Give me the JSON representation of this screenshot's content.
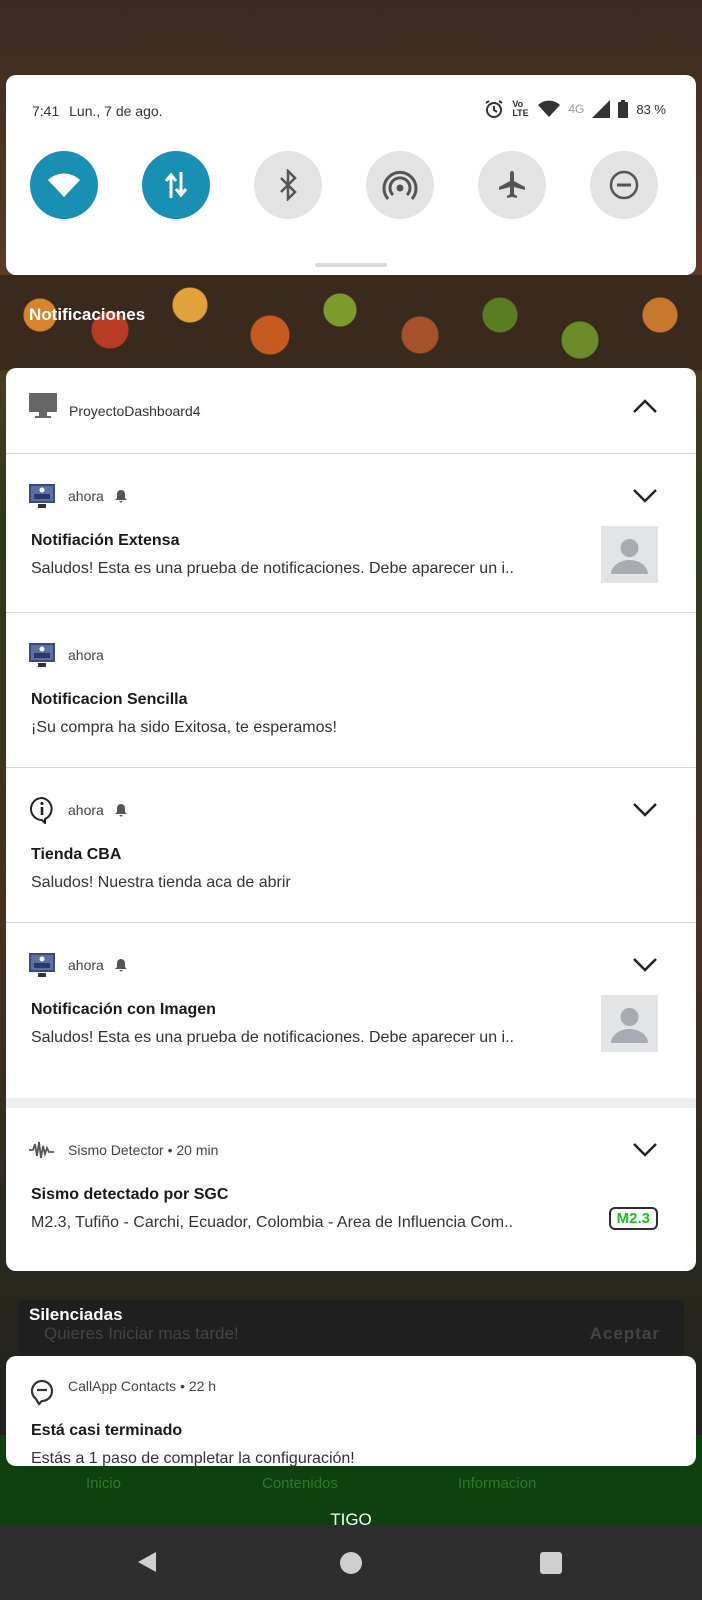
{
  "status_bar": {
    "time": "7:41",
    "date": "Lun., 7 de ago.",
    "volte": "Vo LTE",
    "network": "4G",
    "battery": "83 %"
  },
  "quick_settings": [
    {
      "name": "wifi-icon",
      "active": true
    },
    {
      "name": "mobile-data-icon",
      "active": true
    },
    {
      "name": "bluetooth-icon",
      "active": false
    },
    {
      "name": "hotspot-icon",
      "active": false
    },
    {
      "name": "airplane-icon",
      "active": false
    },
    {
      "name": "do-not-disturb-icon",
      "active": false
    }
  ],
  "notifications_header": "Notificaciones",
  "group": {
    "app_name": "ProyectoDashboard4",
    "items": [
      {
        "time": "ahora",
        "title": "Notifiación Extensa",
        "text": "Saludos! Esta es una prueba de notificaciones. Debe aparecer un i.."
      },
      {
        "time": "ahora",
        "title": "Notificacion Sencilla",
        "text": "¡Su compra ha sido Exitosa, te esperamos!"
      },
      {
        "time": "ahora",
        "title": "Tienda CBA",
        "text": "Saludos! Nuestra tienda aca de abrir"
      },
      {
        "time": "ahora",
        "title": "Notificación con Imagen",
        "text": "Saludos! Esta es una prueba de notificaciones. Debe aparecer un i.."
      }
    ]
  },
  "sismo": {
    "meta": "Sismo Detector • 20 min",
    "title": "Sismo detectado por SGC",
    "text": "M2.3, Tufiño - Carchi, Ecuador, Colombia - Area de Influencia Com..",
    "badge": "M2.3"
  },
  "silenced_header": "Silenciadas",
  "background_app": {
    "toast_text": "Quieres Iniciar mas tarde!",
    "toast_action": "Aceptar",
    "nav": [
      "Inicio",
      "Contenidos",
      "Informacion"
    ]
  },
  "callapp": {
    "meta": "CallApp Contacts • 22 h",
    "title": "Está casi terminado",
    "text": "Estás a 1 paso de completar la configuración!"
  },
  "carrier": "TIGO"
}
